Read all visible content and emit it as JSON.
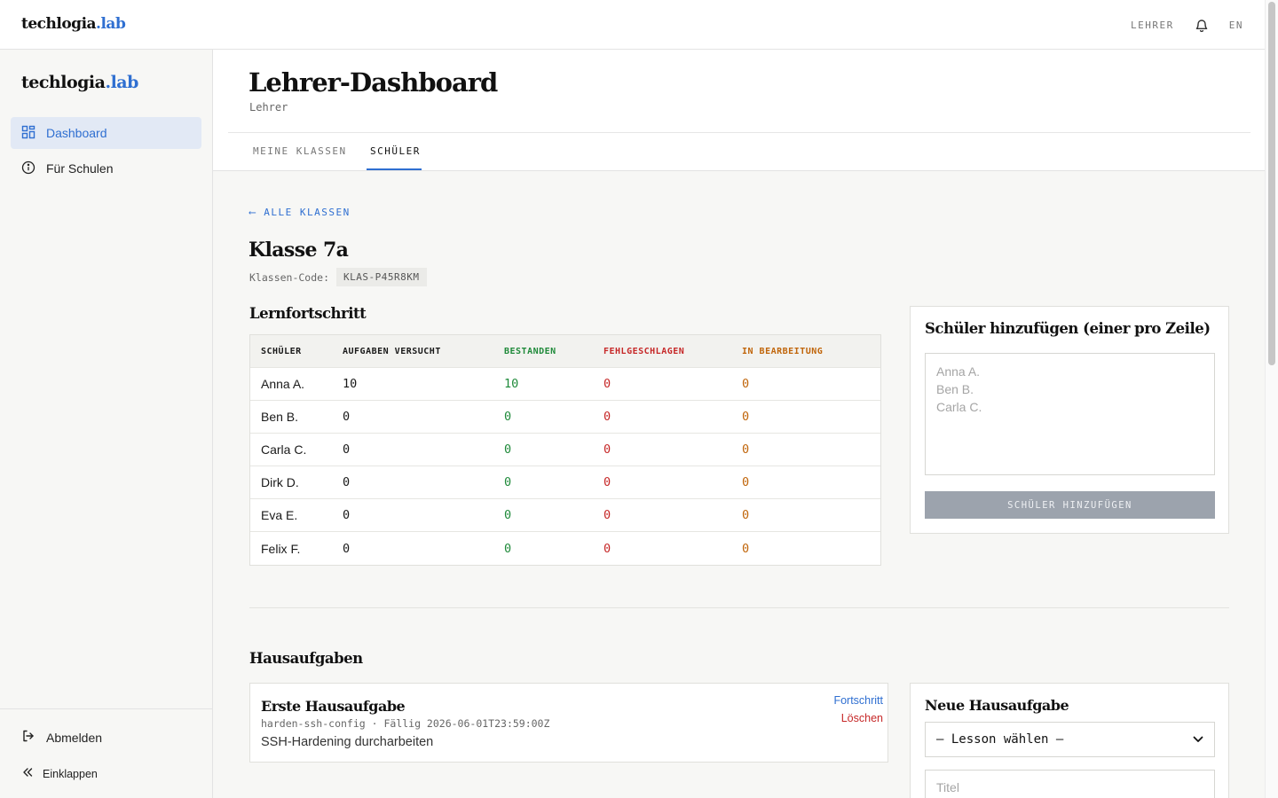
{
  "brand": {
    "name": "techlogia",
    "suffix": ".lab"
  },
  "topbar": {
    "role_label": "LEHRER",
    "lang": "EN",
    "bell_icon": "bell-icon"
  },
  "sidebar": {
    "items": [
      {
        "label": "Dashboard",
        "icon": "dashboard-grid-icon",
        "active": true
      },
      {
        "label": "Für Schulen",
        "icon": "info-circle-icon",
        "active": false
      }
    ],
    "logout_label": "Abmelden",
    "collapse_label": "Einklappen"
  },
  "header": {
    "title": "Lehrer-Dashboard",
    "subtitle": "Lehrer",
    "tabs": [
      {
        "label": "MEINE KLASSEN",
        "active": false
      },
      {
        "label": "SCHÜLER",
        "active": true
      }
    ]
  },
  "class": {
    "back_label": "⟵ ALLE KLASSEN",
    "title": "Klasse 7a",
    "code_label": "Klassen-Code:",
    "code_value": "KLAS-P45R8KM"
  },
  "progress": {
    "title": "Lernfortschritt",
    "columns": [
      "SCHÜLER",
      "AUFGABEN VERSUCHT",
      "BESTANDEN",
      "FEHLGESCHLAGEN",
      "IN BEARBEITUNG"
    ],
    "rows": [
      {
        "name": "Anna A.",
        "attempted": "10",
        "passed": "10",
        "failed": "0",
        "in_progress": "0"
      },
      {
        "name": "Ben B.",
        "attempted": "0",
        "passed": "0",
        "failed": "0",
        "in_progress": "0"
      },
      {
        "name": "Carla C.",
        "attempted": "0",
        "passed": "0",
        "failed": "0",
        "in_progress": "0"
      },
      {
        "name": "Dirk D.",
        "attempted": "0",
        "passed": "0",
        "failed": "0",
        "in_progress": "0"
      },
      {
        "name": "Eva E.",
        "attempted": "0",
        "passed": "0",
        "failed": "0",
        "in_progress": "0"
      },
      {
        "name": "Felix F.",
        "attempted": "0",
        "passed": "0",
        "failed": "0",
        "in_progress": "0"
      }
    ]
  },
  "add_students": {
    "title": "Schüler hinzufügen (einer pro Zeile)",
    "placeholder": "Anna A.\nBen B.\nCarla C.",
    "button_label": "SCHÜLER HINZUFÜGEN"
  },
  "homework": {
    "title": "Hausaufgaben",
    "items": [
      {
        "title": "Erste Hausaufgabe",
        "meta": "harden-ssh-config · Fällig 2026-06-01T23:59:00Z",
        "description": "SSH-Hardening durcharbeiten",
        "progress_link": "Fortschritt",
        "delete_link": "Löschen"
      }
    ],
    "new": {
      "title": "Neue Hausaufgabe",
      "lesson_select": "— Lesson wählen —",
      "title_placeholder": "Titel"
    }
  },
  "colors": {
    "accent": "#2f6fd1",
    "passed": "#1f8a3a",
    "failed": "#c62828",
    "in_progress": "#c0650a"
  }
}
